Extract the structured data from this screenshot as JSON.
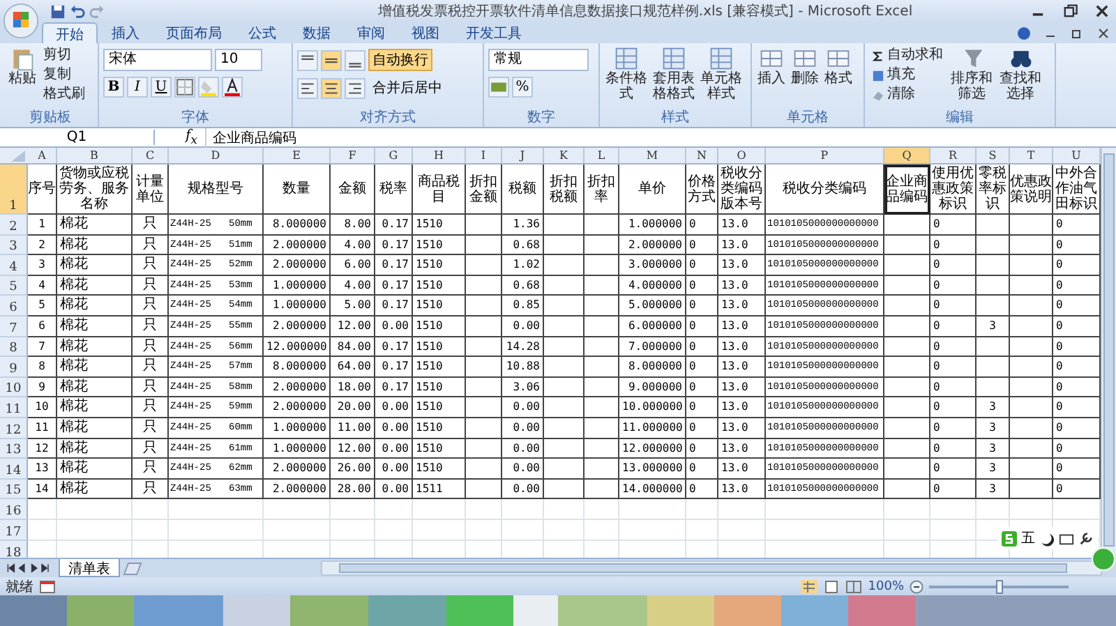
{
  "window": {
    "title": "增值税发票税控开票软件清单信息数据接口规范样例.xls  [兼容模式] - Microsoft Excel"
  },
  "ribbon_tabs": [
    {
      "label": "开始",
      "selected": true
    },
    {
      "label": "插入",
      "selected": false
    },
    {
      "label": "页面布局",
      "selected": false
    },
    {
      "label": "公式",
      "selected": false
    },
    {
      "label": "数据",
      "selected": false
    },
    {
      "label": "审阅",
      "selected": false
    },
    {
      "label": "视图",
      "selected": false
    },
    {
      "label": "开发工具",
      "selected": false
    }
  ],
  "ribbon": {
    "clipboard": {
      "title": "剪贴板",
      "paste": "粘贴",
      "cut": "剪切",
      "copy": "复制",
      "format_painter": "格式刷"
    },
    "font": {
      "title": "字体",
      "font_name": "宋体",
      "font_size": "10",
      "bold": "B",
      "italic": "I",
      "underline": "U"
    },
    "alignment": {
      "title": "对齐方式",
      "wrap_text": {
        "label": "自动换行",
        "on": true
      },
      "merge": "合并后居中"
    },
    "number": {
      "title": "数字",
      "format": "常规",
      "percent": "%"
    },
    "styles": {
      "title": "样式",
      "buttons": [
        "条件格式",
        "套用表格格式",
        "单元格样式"
      ]
    },
    "cells": {
      "title": "单元格",
      "buttons": [
        "插入",
        "删除",
        "格式"
      ]
    },
    "editing": {
      "title": "编辑",
      "autosum": "自动求和",
      "fill": "填充",
      "clear": "清除",
      "sort": "排序和筛选",
      "find": "查找和选择"
    }
  },
  "formula_bar": {
    "name_box": "Q1",
    "fx": "f$_{x}$",
    "content": "企业商品编码"
  },
  "columns": [
    {
      "letter": "A",
      "header": "序号",
      "selected": false
    },
    {
      "letter": "B",
      "header": "货物或应税劳务、服务名称",
      "selected": false
    },
    {
      "letter": "C",
      "header": "计量单位",
      "selected": false
    },
    {
      "letter": "D",
      "header": "规格型号",
      "selected": false
    },
    {
      "letter": "E",
      "header": "数量",
      "selected": false
    },
    {
      "letter": "F",
      "header": "金额",
      "selected": false
    },
    {
      "letter": "G",
      "header": "税率",
      "selected": false
    },
    {
      "letter": "H",
      "header": "商品税目",
      "selected": false
    },
    {
      "letter": "I",
      "header": "折扣金额",
      "selected": false
    },
    {
      "letter": "J",
      "header": "税额",
      "selected": false
    },
    {
      "letter": "K",
      "header": "折扣税额",
      "selected": false
    },
    {
      "letter": "L",
      "header": "折扣率",
      "selected": false
    },
    {
      "letter": "M",
      "header": "单价",
      "selected": false
    },
    {
      "letter": "N",
      "header": "价格方式",
      "selected": false
    },
    {
      "letter": "O",
      "header": "税收分类编码版本号",
      "selected": false
    },
    {
      "letter": "P",
      "header": "税收分类编码",
      "selected": false
    },
    {
      "letter": "Q",
      "header": "企业商品编码",
      "selected": true
    },
    {
      "letter": "R",
      "header": "使用优惠政策标识",
      "selected": false
    },
    {
      "letter": "S",
      "header": "零税率标识",
      "selected": false
    },
    {
      "letter": "T",
      "header": "优惠政策说明",
      "selected": false
    },
    {
      "letter": "U",
      "header": "中外合作油气田标识",
      "selected": false
    }
  ],
  "header_row": {
    "row": "1",
    "selected": true
  },
  "rows": [
    {
      "row": "2",
      "selected": false,
      "cells": {
        "A": "1",
        "B": "棉花",
        "C": "只",
        "D": "Z44H-25   50mm",
        "E": "8.000000",
        "F": "8.00",
        "G": "0.17",
        "H": "1510",
        "J": "1.36",
        "M": "1.000000",
        "N": "0",
        "O": "13.0",
        "P": "1010105000000000000",
        "R": "0",
        "U": "0"
      }
    },
    {
      "row": "3",
      "selected": false,
      "cells": {
        "A": "2",
        "B": "棉花",
        "C": "只",
        "D": "Z44H-25   51mm",
        "E": "2.000000",
        "F": "4.00",
        "G": "0.17",
        "H": "1510",
        "J": "0.68",
        "M": "2.000000",
        "N": "0",
        "O": "13.0",
        "P": "1010105000000000000",
        "R": "0",
        "U": "0"
      }
    },
    {
      "row": "4",
      "selected": false,
      "cells": {
        "A": "3",
        "B": "棉花",
        "C": "只",
        "D": "Z44H-25   52mm",
        "E": "2.000000",
        "F": "6.00",
        "G": "0.17",
        "H": "1510",
        "J": "1.02",
        "M": "3.000000",
        "N": "0",
        "O": "13.0",
        "P": "1010105000000000000",
        "R": "0",
        "U": "0"
      }
    },
    {
      "row": "5",
      "selected": false,
      "cells": {
        "A": "4",
        "B": "棉花",
        "C": "只",
        "D": "Z44H-25   53mm",
        "E": "1.000000",
        "F": "4.00",
        "G": "0.17",
        "H": "1510",
        "J": "0.68",
        "M": "4.000000",
        "N": "0",
        "O": "13.0",
        "P": "1010105000000000000",
        "R": "0",
        "U": "0"
      }
    },
    {
      "row": "6",
      "selected": false,
      "cells": {
        "A": "5",
        "B": "棉花",
        "C": "只",
        "D": "Z44H-25   54mm",
        "E": "1.000000",
        "F": "5.00",
        "G": "0.17",
        "H": "1510",
        "J": "0.85",
        "M": "5.000000",
        "N": "0",
        "O": "13.0",
        "P": "1010105000000000000",
        "R": "0",
        "U": "0"
      }
    },
    {
      "row": "7",
      "selected": false,
      "cells": {
        "A": "6",
        "B": "棉花",
        "C": "只",
        "D": "Z44H-25   55mm",
        "E": "2.000000",
        "F": "12.00",
        "G": "0.00",
        "H": "1510",
        "J": "0.00",
        "M": "6.000000",
        "N": "0",
        "O": "13.0",
        "P": "1010105000000000000",
        "R": "0",
        "S": "3",
        "U": "0"
      }
    },
    {
      "row": "8",
      "selected": false,
      "cells": {
        "A": "7",
        "B": "棉花",
        "C": "只",
        "D": "Z44H-25   56mm",
        "E": "12.000000",
        "F": "84.00",
        "G": "0.17",
        "H": "1510",
        "J": "14.28",
        "M": "7.000000",
        "N": "0",
        "O": "13.0",
        "P": "1010105000000000000",
        "R": "0",
        "U": "0"
      }
    },
    {
      "row": "9",
      "selected": false,
      "cells": {
        "A": "8",
        "B": "棉花",
        "C": "只",
        "D": "Z44H-25   57mm",
        "E": "8.000000",
        "F": "64.00",
        "G": "0.17",
        "H": "1510",
        "J": "10.88",
        "M": "8.000000",
        "N": "0",
        "O": "13.0",
        "P": "1010105000000000000",
        "R": "0",
        "U": "0"
      }
    },
    {
      "row": "10",
      "selected": false,
      "cells": {
        "A": "9",
        "B": "棉花",
        "C": "只",
        "D": "Z44H-25   58mm",
        "E": "2.000000",
        "F": "18.00",
        "G": "0.17",
        "H": "1510",
        "J": "3.06",
        "M": "9.000000",
        "N": "0",
        "O": "13.0",
        "P": "1010105000000000000",
        "R": "0",
        "U": "0"
      }
    },
    {
      "row": "11",
      "selected": false,
      "cells": {
        "A": "10",
        "B": "棉花",
        "C": "只",
        "D": "Z44H-25   59mm",
        "E": "2.000000",
        "F": "20.00",
        "G": "0.00",
        "H": "1510",
        "J": "0.00",
        "M": "10.000000",
        "N": "0",
        "O": "13.0",
        "P": "1010105000000000000",
        "R": "0",
        "S": "3",
        "U": "0"
      }
    },
    {
      "row": "12",
      "selected": false,
      "cells": {
        "A": "11",
        "B": "棉花",
        "C": "只",
        "D": "Z44H-25   60mm",
        "E": "1.000000",
        "F": "11.00",
        "G": "0.00",
        "H": "1510",
        "J": "0.00",
        "M": "11.000000",
        "N": "0",
        "O": "13.0",
        "P": "1010105000000000000",
        "R": "0",
        "S": "3",
        "U": "0"
      }
    },
    {
      "row": "13",
      "selected": false,
      "cells": {
        "A": "12",
        "B": "棉花",
        "C": "只",
        "D": "Z44H-25   61mm",
        "E": "1.000000",
        "F": "12.00",
        "G": "0.00",
        "H": "1510",
        "J": "0.00",
        "M": "12.000000",
        "N": "0",
        "O": "13.0",
        "P": "1010105000000000000",
        "R": "0",
        "S": "3",
        "U": "0"
      }
    },
    {
      "row": "14",
      "selected": false,
      "cells": {
        "A": "13",
        "B": "棉花",
        "C": "只",
        "D": "Z44H-25   62mm",
        "E": "2.000000",
        "F": "26.00",
        "G": "0.00",
        "H": "1510",
        "J": "0.00",
        "M": "13.000000",
        "N": "0",
        "O": "13.0",
        "P": "1010105000000000000",
        "R": "0",
        "S": "3",
        "U": "0"
      }
    },
    {
      "row": "15",
      "selected": false,
      "cells": {
        "A": "14",
        "B": "棉花",
        "C": "只",
        "D": "Z44H-25   63mm",
        "E": "2.000000",
        "F": "28.00",
        "G": "0.00",
        "H": "1511",
        "J": "0.00",
        "M": "14.000000",
        "N": "0",
        "O": "13.0",
        "P": "1010105000000000000",
        "R": "0",
        "S": "3",
        "U": "0"
      }
    }
  ],
  "empty_rows": [
    "16",
    "17",
    "18"
  ],
  "sheet_tabs": [
    {
      "label": "清单表",
      "selected": true
    }
  ],
  "ime_bar": {
    "mode": "五"
  },
  "status_bar": {
    "status": "就绪",
    "zoom": {
      "label": "100%",
      "level": 0.5
    }
  }
}
